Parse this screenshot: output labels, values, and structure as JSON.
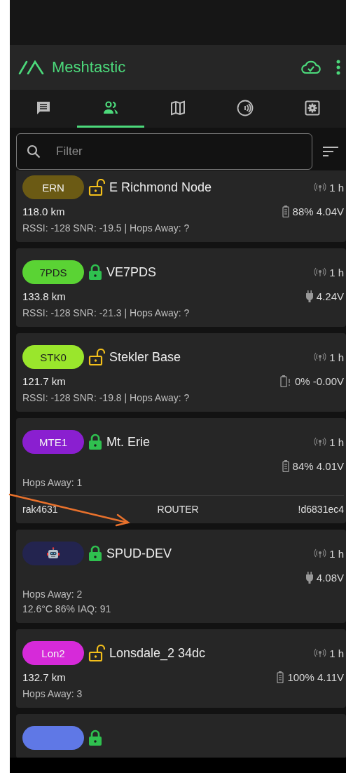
{
  "app_bar": {
    "title": "Meshtastic",
    "connected": true
  },
  "tabs": [
    {
      "kind": "messages",
      "selected": false
    },
    {
      "kind": "nodes",
      "selected": true
    },
    {
      "kind": "map",
      "selected": false
    },
    {
      "kind": "channels",
      "selected": false
    },
    {
      "kind": "settings",
      "selected": false
    }
  ],
  "search": {
    "placeholder": "Filter"
  },
  "nodes": [
    {
      "short_name": "ERN",
      "kind": "text",
      "color": "#6b5a14",
      "badge_text_dark": false,
      "locked": false,
      "name": "E Richmond Node",
      "last_heard": "1 h",
      "distance": "118.0 km",
      "power": {
        "kind": "battery",
        "reading": "88% 4.04V"
      },
      "lines": [
        "RSSI: -128 SNR: -19.5 | Hops Away: ?"
      ]
    },
    {
      "short_name": "7PDS",
      "kind": "text",
      "color": "#5ad334",
      "badge_text_dark": true,
      "locked": true,
      "name": "VE7PDS",
      "last_heard": "1 h",
      "distance": "133.8 km",
      "power": {
        "kind": "plugged",
        "reading": "4.24V"
      },
      "lines": [
        "RSSI: -128 SNR: -21.3 | Hops Away: ?"
      ]
    },
    {
      "short_name": "STK0",
      "kind": "text",
      "color": "#9ae62c",
      "badge_text_dark": true,
      "locked": false,
      "name": "Stekler Base",
      "last_heard": "1 h",
      "distance": "121.7 km",
      "power": {
        "kind": "battery_empty",
        "reading": "0% -0.00V"
      },
      "lines": [
        "RSSI: -128 SNR: -19.8 | Hops Away: ?"
      ]
    },
    {
      "short_name": "MTE1",
      "kind": "text",
      "color": "#8a1fd0",
      "badge_text_dark": false,
      "locked": true,
      "name": "Mt. Erie",
      "last_heard": "1 h",
      "power": {
        "kind": "battery",
        "reading": "84% 4.01V"
      },
      "lines": [
        "Hops Away: 1"
      ],
      "footer": [
        "rak4631",
        "ROUTER",
        "!d6831ec4"
      ]
    },
    {
      "kind": "robot",
      "color": "#23244f",
      "locked": true,
      "name": "SPUD-DEV",
      "last_heard": "1 h",
      "power": {
        "kind": "plugged",
        "reading": "4.08V"
      },
      "lines": [
        "Hops Away: 2",
        "12.6°C 86% IAQ: 91"
      ]
    },
    {
      "short_name": "Lon2",
      "kind": "text",
      "color": "#d62ad9",
      "badge_text_dark": false,
      "locked": false,
      "name": "Lonsdale_2 34dc",
      "last_heard": "1 h",
      "distance": "132.7 km",
      "power": {
        "kind": "battery",
        "reading": "100% 4.11V"
      },
      "lines": [
        "Hops Away: 3"
      ]
    },
    {
      "color": "#5f78e6",
      "locked": true
    }
  ]
}
